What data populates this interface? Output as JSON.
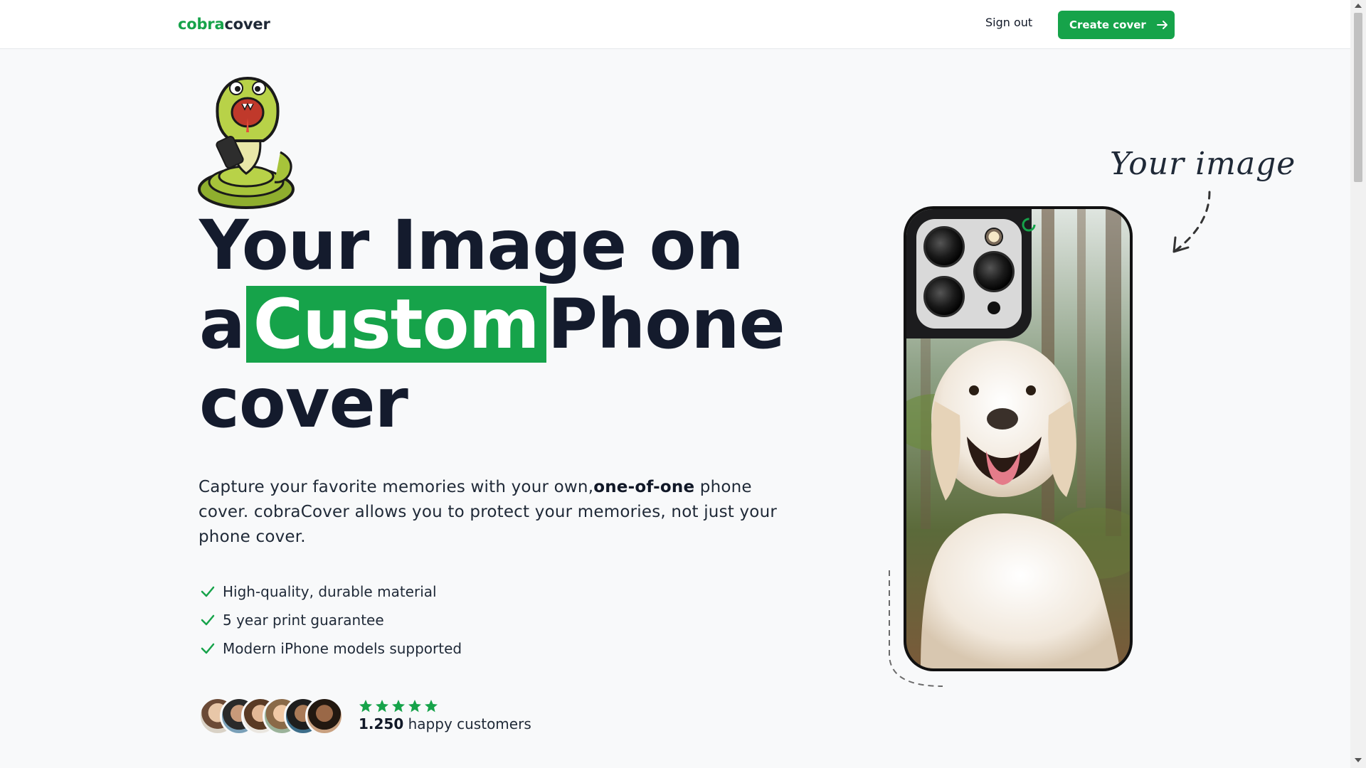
{
  "nav": {
    "brand_primary": "cobra",
    "brand_secondary": "cover",
    "signout_label": "Sign out",
    "cta_label": "Create cover"
  },
  "hero": {
    "headline_line1": "Your Image on",
    "headline_prefix": "a",
    "headline_highlight": "Custom",
    "headline_suffix": "Phone",
    "headline_line3": "cover",
    "desc_part1": "Capture your favorite memories with your own,",
    "desc_bold": "one-of-one",
    "desc_part2": " phone cover. cobraCover allows you to protect your memories, not just your phone cover.",
    "features": [
      "High-quality, durable material",
      "5 year print guarantee",
      "Modern iPhone models supported"
    ],
    "rating_stars": 5,
    "customers_count": "1.250",
    "customers_label": " happy customers"
  },
  "showcase": {
    "annotation": "Your image"
  },
  "colors": {
    "accent": "#16a34a",
    "text_dark": "#141b2d",
    "background": "#f8f9fa"
  },
  "icons": {
    "mascot": "cobra-snake-icon",
    "cta": "arrow-right-icon",
    "feature": "check-icon",
    "rating": "star-icon"
  }
}
